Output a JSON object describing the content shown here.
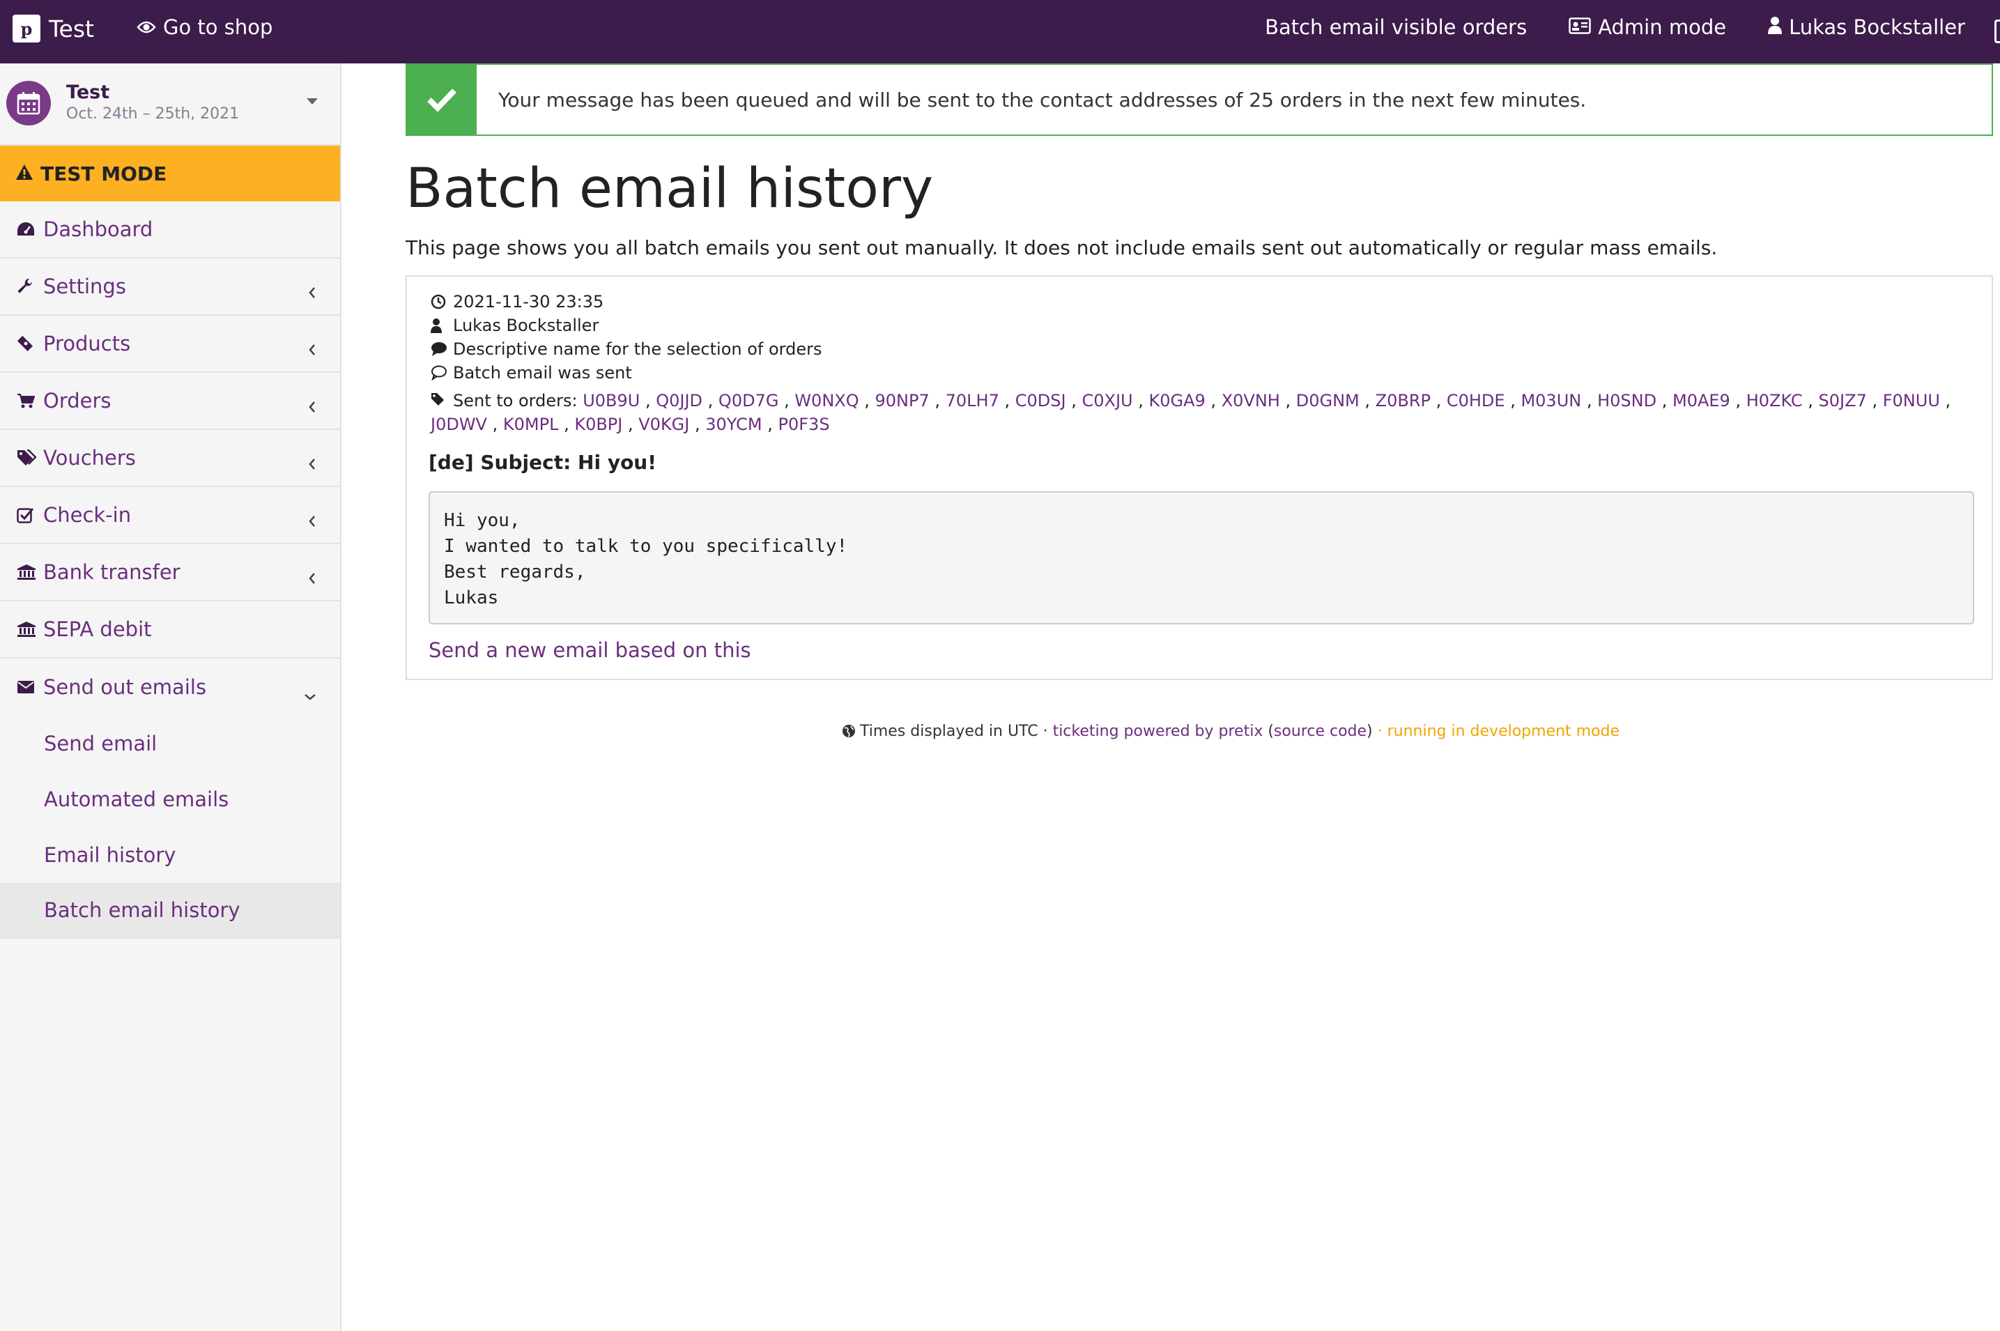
{
  "topbar": {
    "logo_text": "p",
    "brand": "Test",
    "go_to_shop": "Go to shop",
    "batch_email": "Batch email visible orders",
    "admin_mode": "Admin mode",
    "user": "Lukas Bockstaller",
    "bg_color": "#3b1c4a"
  },
  "sidebar": {
    "event_name": "Test",
    "event_dates": "Oct. 24th – 25th, 2021",
    "test_mode": "TEST MODE",
    "items": [
      {
        "label": "Dashboard",
        "icon": "dashboard-icon"
      },
      {
        "label": "Settings",
        "icon": "wrench-icon"
      },
      {
        "label": "Products",
        "icon": "ticket-icon"
      },
      {
        "label": "Orders",
        "icon": "cart-icon"
      },
      {
        "label": "Vouchers",
        "icon": "tags-icon"
      },
      {
        "label": "Check-in",
        "icon": "check-square-icon"
      },
      {
        "label": "Bank transfer",
        "icon": "bank-icon"
      },
      {
        "label": "SEPA debit",
        "icon": "bank-icon"
      },
      {
        "label": "Send out emails",
        "icon": "envelope-icon"
      }
    ],
    "sub_items": [
      {
        "label": "Send email"
      },
      {
        "label": "Automated emails"
      },
      {
        "label": "Email history"
      },
      {
        "label": "Batch email history"
      }
    ]
  },
  "alert": {
    "message": "Your message has been queued and will be sent to the contact addresses of 25 orders in the next few minutes."
  },
  "main": {
    "title": "Batch email history",
    "description": "This page shows you all batch emails you sent out manually. It does not include emails sent out automatically or regular mass emails."
  },
  "entry": {
    "datetime": "2021-11-30 23:35",
    "user": "Lukas Bockstaller",
    "selection_name": "Descriptive name for the selection of orders",
    "status": "Batch email was sent",
    "sent_to_label": "Sent to orders:",
    "orders": [
      "U0B9U",
      "Q0JJD",
      "Q0D7G",
      "W0NXQ",
      "90NP7",
      "70LH7",
      "C0DSJ",
      "C0XJU",
      "K0GA9",
      "X0VNH",
      "D0GNM",
      "Z0BRP",
      "C0HDE",
      "M03UN",
      "H0SND",
      "M0AE9",
      "H0ZKC",
      "S0JZ7",
      "F0NUU",
      "J0DWV",
      "K0MPL",
      "K0BPJ",
      "V0KGJ",
      "30YCM",
      "P0F3S"
    ],
    "subject": "[de] Subject: Hi you!",
    "body": "Hi you,\nI wanted to talk to you specifically!\nBest regards,\nLukas",
    "send_new": "Send a new email based on this"
  },
  "footer": {
    "times": "Times displayed in UTC",
    "sep1": " · ",
    "powered": "ticketing powered by pretix",
    "open_paren": " (",
    "source": "source code",
    "close_paren": ")",
    "sep2": " · ",
    "dev_mode": "running in development mode"
  }
}
